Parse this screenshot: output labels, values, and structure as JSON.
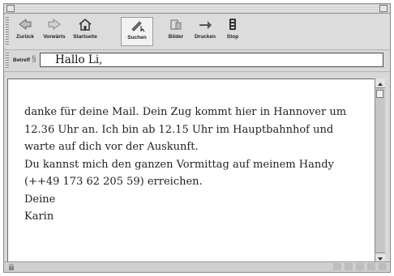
{
  "toolbar": {
    "buttons": [
      {
        "label": "Zurück",
        "icon": "back-arrow-icon"
      },
      {
        "label": "Vorwärts",
        "icon": "forward-arrow-icon"
      },
      {
        "label": "Startseite",
        "icon": "home-icon"
      },
      {
        "label": "Suchen",
        "icon": "search-icon"
      },
      {
        "label": "Bilder",
        "icon": "images-icon"
      },
      {
        "label": "Drucken",
        "icon": "print-icon"
      },
      {
        "label": "Stop",
        "icon": "stop-icon"
      }
    ]
  },
  "subject": {
    "label": "Betreff",
    "value": "Hallo Li,"
  },
  "message": {
    "lines": [
      "danke für deine Mail. Dein Zug kommt hier in Hannover um",
      "12.36 Uhr an. Ich bin ab 12.15 Uhr im Hauptbahnhof und",
      "warte auf dich vor der Auskunft.",
      "Du kannst mich den ganzen Vormittag auf meinem Handy",
      "(++49 173 62 205 59) erreichen.",
      "Deine",
      "Karin"
    ]
  }
}
